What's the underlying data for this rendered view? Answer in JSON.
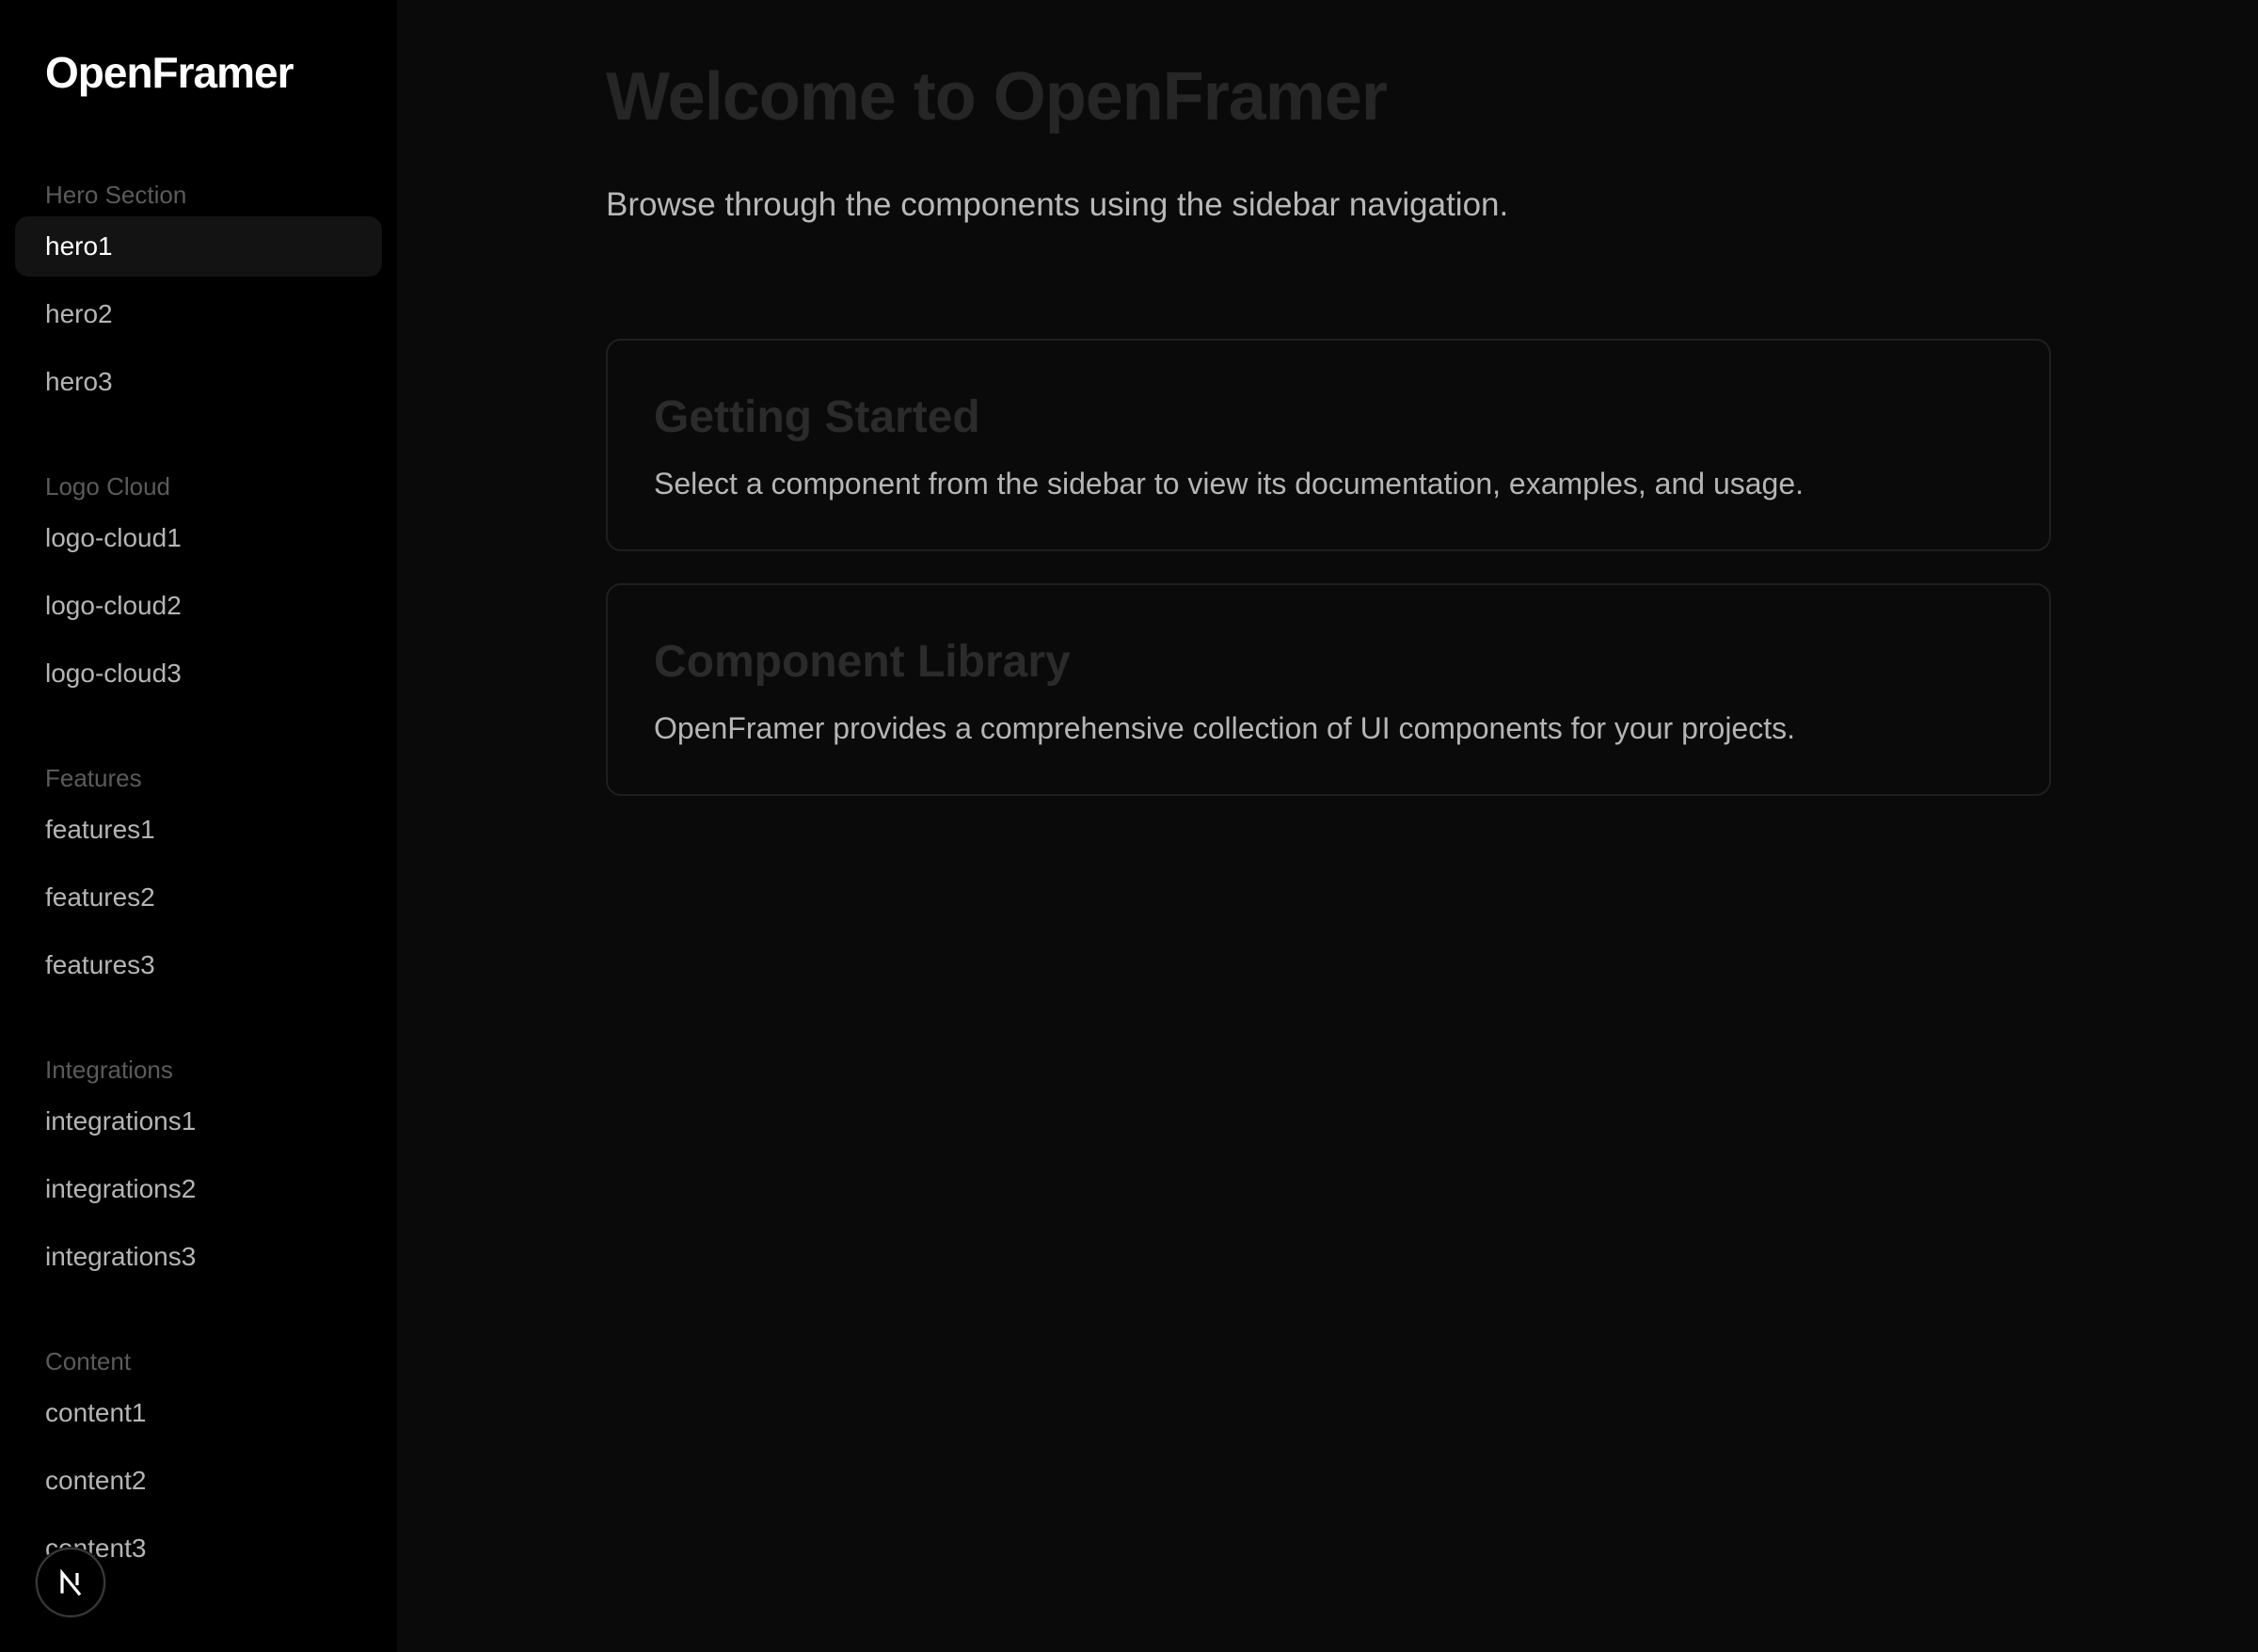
{
  "sidebar": {
    "logo": "OpenFramer",
    "sections": [
      {
        "title": "Hero Section",
        "items": [
          "hero1",
          "hero2",
          "hero3"
        ]
      },
      {
        "title": "Logo Cloud",
        "items": [
          "logo-cloud1",
          "logo-cloud2",
          "logo-cloud3"
        ]
      },
      {
        "title": "Features",
        "items": [
          "features1",
          "features2",
          "features3"
        ]
      },
      {
        "title": "Integrations",
        "items": [
          "integrations1",
          "integrations2",
          "integrations3"
        ]
      },
      {
        "title": "Content",
        "items": [
          "content1",
          "content2",
          "content3"
        ]
      }
    ],
    "active_item": "hero1",
    "fab_icon": "nextjs-icon"
  },
  "main": {
    "title": "Welcome to OpenFramer",
    "subtitle": "Browse through the components using the sidebar navigation.",
    "cards": [
      {
        "title": "Getting Started",
        "text": "Select a component from the sidebar to view its documentation, examples, and usage."
      },
      {
        "title": "Component Library",
        "text": "OpenFramer provides a comprehensive collection of UI components for your projects."
      }
    ]
  },
  "colors": {
    "sidebar_bg": "#000000",
    "main_bg": "#0a0a0a",
    "active_item_bg": "#131313"
  }
}
